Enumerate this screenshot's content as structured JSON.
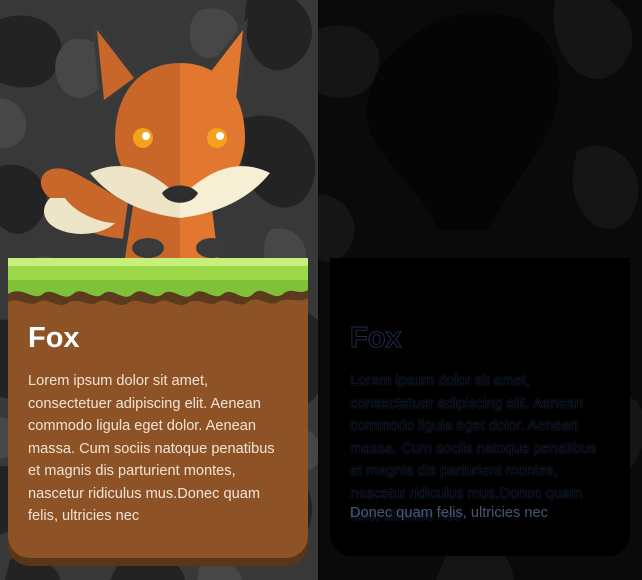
{
  "card_left": {
    "title": "Fox",
    "body": "Lorem ipsum dolor sit amet, consectetuer adipiscing elit. Aenean commodo ligula eget dolor. Aenean massa. Cum sociis natoque penatibus et magnis dis parturient montes, nascetur ridiculus mus.Donec quam felis, ultricies nec"
  },
  "card_right": {
    "title": "Fox",
    "body": "Lorem ipsum dolor sit amet, consectetuer adipiscing elit. Aenean commodo ligula eget dolor. Aenean massa. Cum sociis natoque penatibus et magnis dis parturient montes, nascetur ridiculus mus.Donec quam felis, ultricies nec",
    "overlay_text": "Donec quam felis, ultricies nec"
  },
  "icons": {
    "mascot": "fox-icon",
    "ground": "grass-icon"
  },
  "colors": {
    "fox_orange": "#e2782f",
    "fox_dark_orange": "#c9662a",
    "fox_cream": "#eee4c8",
    "card_brown": "#8d5327",
    "grass_green": "#a6e04a",
    "background_left": "#383838",
    "background_right": "#0a0a0a"
  }
}
